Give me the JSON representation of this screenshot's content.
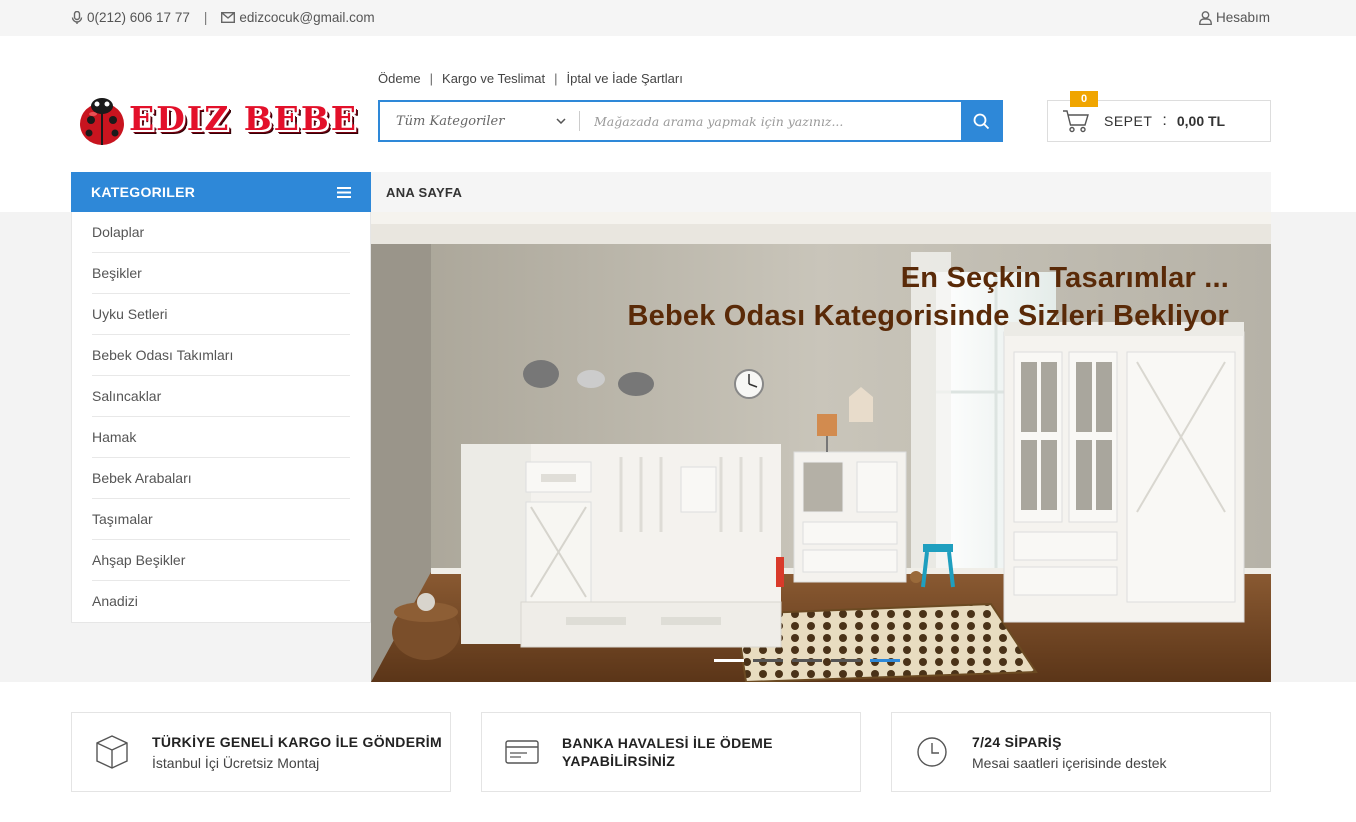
{
  "topbar": {
    "phone": "0(212) 606 17 77",
    "separator": "|",
    "email": "edizcocuk@gmail.com",
    "account": "Hesabım"
  },
  "logo": {
    "text": "EDIZ BEBE"
  },
  "infolinks": [
    "Ödeme",
    "Kargo ve Teslimat",
    "İptal ve İade Şartları"
  ],
  "search": {
    "category": "Tüm Kategoriler",
    "placeholder": "Mağazada arama yapmak için yazınız..."
  },
  "cart": {
    "count": "0",
    "label": "SEPET",
    "colon": ":",
    "total": "0,00 TL"
  },
  "sidebar": {
    "title": "KATEGORILER",
    "items": [
      "Dolaplar",
      "Beşikler",
      "Uyku Setleri",
      "Bebek Odası Takımları",
      "Salıncaklar",
      "Hamak",
      "Bebek Arabaları",
      "Taşımalar",
      "Ahşap Beşikler",
      "Anadizi"
    ]
  },
  "nav": {
    "home": "ANA SAYFA"
  },
  "banner": {
    "line1": "En Seçkin Tasarımlar ...",
    "line2": "Bebek Odası Kategorisinde Sizleri Bekliyor"
  },
  "features": [
    {
      "title": "TÜRKİYE GENELİ KARGO İLE GÖNDERİM",
      "subtitle": "İstanbul İçi Ücretsiz Montaj",
      "icon": "box-icon"
    },
    {
      "title": "BANKA HAVALESİ İLE ÖDEME YAPABİLİRSİNİZ",
      "subtitle": "",
      "icon": "credit-card-icon"
    },
    {
      "title": "7/24 SİPARİŞ",
      "subtitle": "Mesai saatleri içerisinde destek",
      "icon": "clock-icon"
    }
  ],
  "colors": {
    "accent": "#2e88d8",
    "badge": "#f0a500",
    "caption": "#5a2a08",
    "logo": "#e3102a"
  }
}
